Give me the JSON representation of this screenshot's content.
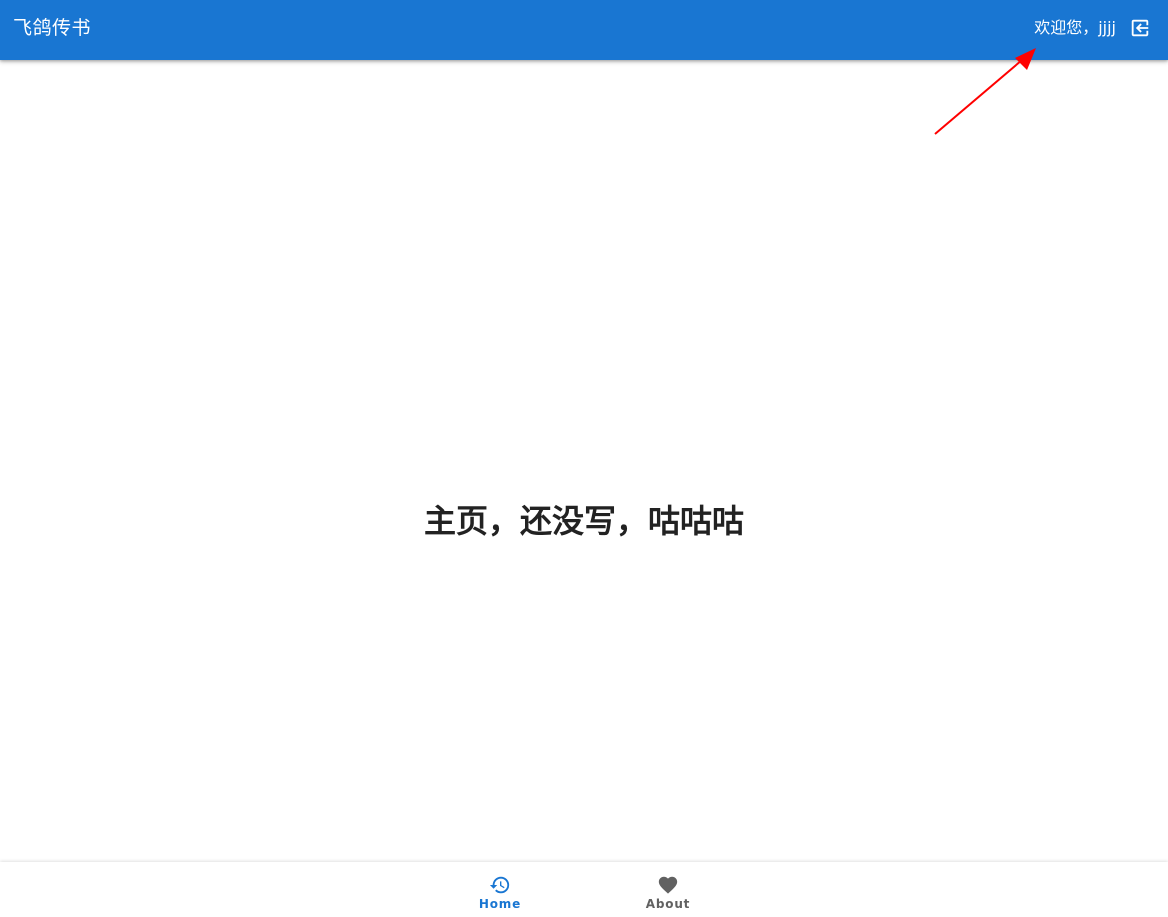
{
  "app_bar": {
    "title": "飞鸽传书",
    "welcome_text": "欢迎您，jjjj",
    "logout_icon": "logout-icon"
  },
  "main": {
    "heading": "主页，还没写，咕咕咕"
  },
  "bottom_nav": {
    "items": [
      {
        "label": "Home",
        "icon": "history-icon",
        "active": true
      },
      {
        "label": "About",
        "icon": "heart-icon",
        "active": false
      }
    ]
  },
  "colors": {
    "primary": "#1976d2",
    "annotation": "#ff0000",
    "inactive": "#616161",
    "heading": "#222222"
  }
}
